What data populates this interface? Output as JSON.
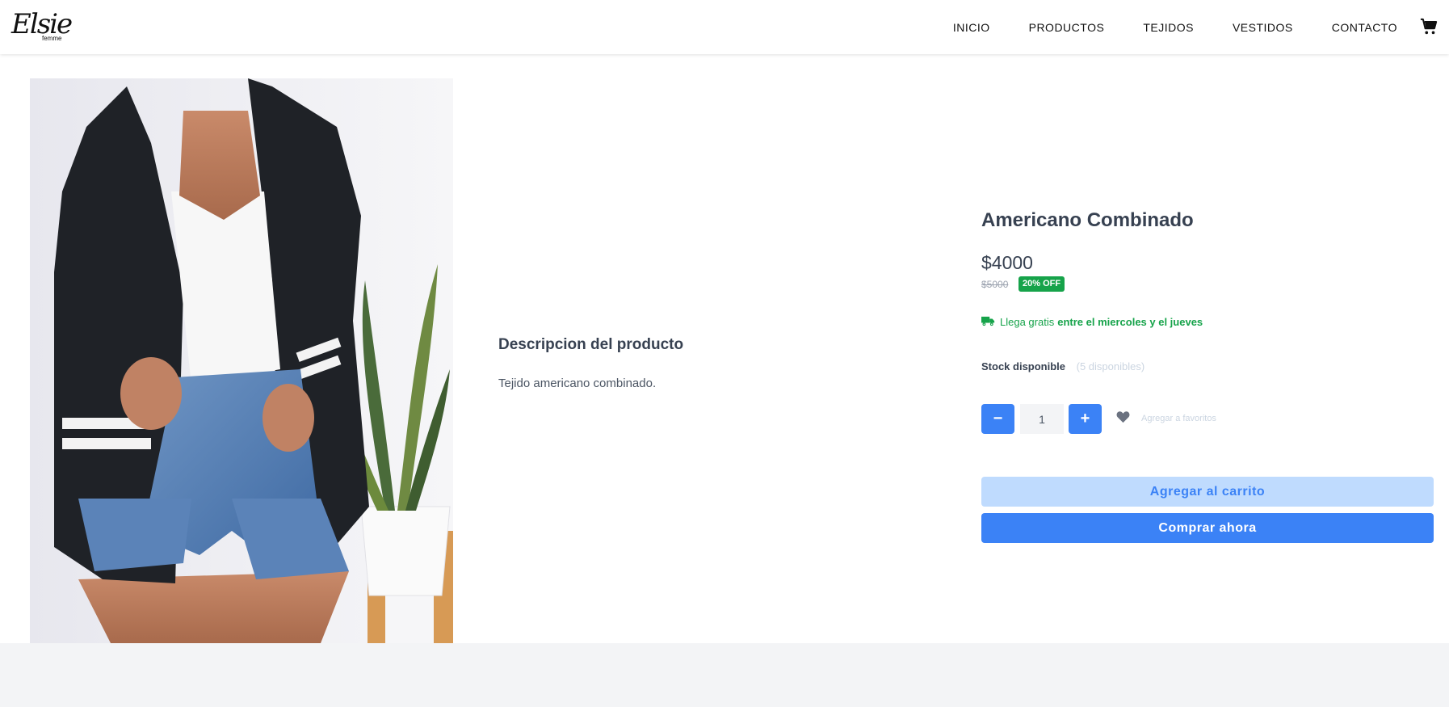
{
  "brand": {
    "logo_text": "Elsie",
    "logo_subtext": "femme"
  },
  "nav": {
    "items": [
      {
        "label": "INICIO"
      },
      {
        "label": "PRODUCTOS"
      },
      {
        "label": "TEJIDOS"
      },
      {
        "label": "VESTIDOS"
      },
      {
        "label": "CONTACTO"
      }
    ],
    "cart_icon": "shopping-cart-icon"
  },
  "description": {
    "title": "Descripcion del producto",
    "text": "Tejido americano combinado."
  },
  "product": {
    "title": "Americano Combinado",
    "price": "$4000",
    "old_price": "$5000",
    "discount_badge": "20% OFF",
    "shipping_prefix": "Llega gratis",
    "shipping_days": "entre el miercoles y el jueves",
    "shipping_icon": "truck-icon",
    "stock_label": "Stock disponible",
    "stock_count": "(5 disponibles)",
    "quantity": "1",
    "minus_label": "−",
    "plus_label": "+",
    "favorite_label": "Agregar a favoritos",
    "favorite_icon": "heart-icon",
    "add_to_cart_label": "Agregar al carrito",
    "buy_now_label": "Comprar ahora"
  },
  "colors": {
    "primary": "#3b82f6",
    "primary_light": "#bfdbfe",
    "success": "#16a34a",
    "text": "#374151",
    "muted": "#cbd5e1",
    "footer_bg": "#f3f4f6"
  }
}
